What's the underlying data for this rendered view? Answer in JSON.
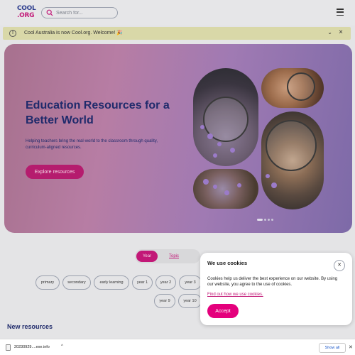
{
  "header": {
    "logo_top": "COOL",
    "logo_bottom": ".ORG",
    "search_placeholder": "Search for..."
  },
  "notice": {
    "text": "Cool Australia is now Cool.org. Welcome! 🎉"
  },
  "hero": {
    "title": "Education Resources for a Better World",
    "subtitle": "Helping teachers bring the real-world to the classroom through quality, curriculum-aligned resources.",
    "cta_label": "Explore resources",
    "carousel": {
      "slides": 4,
      "active_index": 0
    }
  },
  "filters": {
    "tabs": [
      {
        "label": "Year",
        "active": true
      },
      {
        "label": "Topic",
        "active": false
      }
    ],
    "chips": [
      "primary",
      "secondary",
      "early learning",
      "year 1",
      "year 2",
      "year 9",
      "year 10"
    ]
  },
  "new_resources": {
    "title": "New resources"
  },
  "cookie": {
    "title": "We use cookies",
    "close_label": "✕",
    "body": "Cookies help us deliver the best experience on our website. By using our website, you agree to the use of cookies.",
    "link_label": "Find out how we use cookies.",
    "accept_label": "Accept"
  },
  "downloads": {
    "file_name": "20230929....exe.info",
    "show_all_label": "Show all",
    "close_label": "✕"
  },
  "colors": {
    "brand_pink": "#c21877",
    "brand_navy": "#1f2a6b",
    "accept_pink": "#e4007c",
    "notice_bg": "#d9d8a8"
  }
}
